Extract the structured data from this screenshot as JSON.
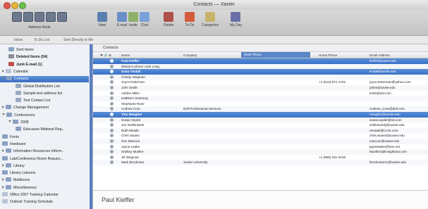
{
  "window": {
    "title": "Contacts — Xavier"
  },
  "toolbar": {
    "address_book_label": "Address Book",
    "items": [
      {
        "label": "New",
        "icon": "new-contact-icon",
        "color": "#5a7fb0"
      },
      {
        "label": "E-mail",
        "icon": "email-icon",
        "color": "#6a8fc6"
      },
      {
        "label": "Invite",
        "icon": "invite-icon",
        "color": "#8fb06a"
      },
      {
        "label": "Chat",
        "icon": "chat-icon",
        "color": "#7aa2d8"
      },
      {
        "label": "Delete",
        "icon": "delete-icon",
        "color": "#b0504a"
      },
      {
        "label": "To Do",
        "icon": "flag-icon",
        "color": "#d45a3a"
      },
      {
        "label": "Categories",
        "icon": "categories-icon",
        "color": "#c9b26a"
      },
      {
        "label": "My Day",
        "icon": "my-day-icon",
        "color": "#6b6fa8"
      }
    ]
  },
  "nav": {
    "inbox": "Inbox",
    "todo_list": "To Do List",
    "sent_directly": "Sent Directly to Me"
  },
  "sidebar": {
    "items": [
      {
        "label": "Sent Items",
        "level": 1,
        "icon": "folder-icon"
      },
      {
        "label": "Deleted Items (54)",
        "level": 1,
        "icon": "trash-icon",
        "bold": true
      },
      {
        "label": "Junk E-mail (1)",
        "level": 1,
        "icon": "junk-icon",
        "bold": true
      },
      {
        "label": "Calendar",
        "level": 0,
        "icon": "calendar-icon",
        "expand": "closed"
      },
      {
        "label": "Contacts",
        "level": 0,
        "icon": "contacts-icon",
        "expand": "open",
        "selected": true
      },
      {
        "label": "Global Distribution List",
        "level": 2,
        "icon": "list-icon"
      },
      {
        "label": "Sample test address list",
        "level": 2,
        "icon": "list-icon"
      },
      {
        "label": "Test Contact List",
        "level": 2,
        "icon": "list-icon"
      },
      {
        "label": "Change Management",
        "level": 0,
        "icon": "folder-icon",
        "expand": "closed"
      },
      {
        "label": "Conferences",
        "level": 0,
        "icon": "folder-icon",
        "expand": "open"
      },
      {
        "label": "2008",
        "level": 1,
        "icon": "folder-icon",
        "expand": "open"
      },
      {
        "label": "Educause Midwest Reg...",
        "level": 2,
        "icon": "folder-icon"
      },
      {
        "label": "Fonts",
        "level": 0,
        "icon": "folder-icon"
      },
      {
        "label": "Hardware",
        "level": 0,
        "icon": "folder-icon"
      },
      {
        "label": "Information Resources Inform...",
        "level": 0,
        "icon": "folder-icon",
        "expand": "closed"
      },
      {
        "label": "Lab/Conference Room Reques...",
        "level": 0,
        "icon": "folder-icon"
      },
      {
        "label": "Library",
        "level": 0,
        "icon": "folder-icon",
        "expand": "closed"
      },
      {
        "label": "Library Liaisons",
        "level": 0,
        "icon": "folder-icon"
      },
      {
        "label": "Mailboxes",
        "level": 0,
        "icon": "folder-icon",
        "expand": "closed"
      },
      {
        "label": "Miscellaneous",
        "level": 0,
        "icon": "folder-icon",
        "expand": "closed"
      },
      {
        "label": "Office 2007 Training Calendar",
        "level": 0,
        "icon": "calendar-icon"
      },
      {
        "label": "Outlook Training Schedule",
        "level": 0,
        "icon": "calendar-icon"
      }
    ]
  },
  "main": {
    "header": "Contacts",
    "columns": {
      "name": "Name",
      "company": "Company",
      "work_phone": "Work Phone",
      "home_phone": "Home Phone",
      "email": "Email Address"
    },
    "rows": [
      {
        "name": "Paul Kieffer",
        "company": "",
        "work": "",
        "home": "",
        "email": "kieffer@xavier.edu",
        "selected": true
      },
      {
        "name": "distance phone code Long",
        "company": "",
        "work": "",
        "home": "",
        "email": ""
      },
      {
        "name": "Dana Tindall",
        "company": "",
        "work": "",
        "home": "",
        "email": "tindall@xavier.edu",
        "selected": true
      },
      {
        "name": "Christy Wegman",
        "company": "",
        "work": "",
        "home": "",
        "email": ""
      },
      {
        "name": "Joyce Esterman",
        "company": "",
        "work": "",
        "home": "+1 (513) 871-1722",
        "email": "joyce.Esterman@yahoo.com"
      },
      {
        "name": "John Smith",
        "company": "",
        "work": "",
        "home": "",
        "email": "johns@xavier.edu"
      },
      {
        "name": "Ashlee Miller",
        "company": "",
        "work": "",
        "home": "",
        "email": "test2@aol.com"
      },
      {
        "name": "Kathleen Sweeney",
        "company": "",
        "work": "",
        "home": "",
        "email": ""
      },
      {
        "name": "Stephanie Rose",
        "company": "",
        "work": "",
        "home": "",
        "email": ""
      },
      {
        "name": "Andrew Core",
        "company": "Dell Professional Services",
        "work": "",
        "home": "",
        "email": "Andrew_Core@dell.com"
      },
      {
        "name": "Tina Meagher",
        "company": "",
        "work": "",
        "home": "",
        "email": "meagher@xavier.edu",
        "selected": true
      },
      {
        "name": "Susan Wyder",
        "company": "",
        "work": "",
        "home": "",
        "email": "susan.wyder@53.com"
      },
      {
        "name": "Joe Stollenwerk",
        "company": "",
        "work": "",
        "home": "",
        "email": "stollenwerkj@xavier.edu"
      },
      {
        "name": "Ruth Meade",
        "company": "",
        "work": "",
        "home": "",
        "email": "rmeade@cccis.com"
      },
      {
        "name": "Chris Swann",
        "company": "",
        "work": "",
        "home": "",
        "email": "chris.swann@xavier.edu"
      },
      {
        "name": "Ron Marcum",
        "company": "",
        "work": "",
        "home": "",
        "email": "marcum@xavier.edu"
      },
      {
        "name": "Jayne Laake",
        "company": "",
        "work": "",
        "home": "",
        "email": "jaynelaake@fuse.net"
      },
      {
        "name": "Shelley Mueller",
        "company": "",
        "work": "",
        "home": "",
        "email": "Mueller3@insightmia.com"
      },
      {
        "name": "Jill Wegman",
        "company": "",
        "work": "",
        "home": "+1 (859) 331-0218",
        "email": ""
      },
      {
        "name": "Mark Brockman",
        "company": "Xavier University",
        "work": "",
        "home": "",
        "email": "brockmanm1@xavier.edu"
      }
    ]
  },
  "preview": {
    "name": "Paul Kieffer"
  }
}
